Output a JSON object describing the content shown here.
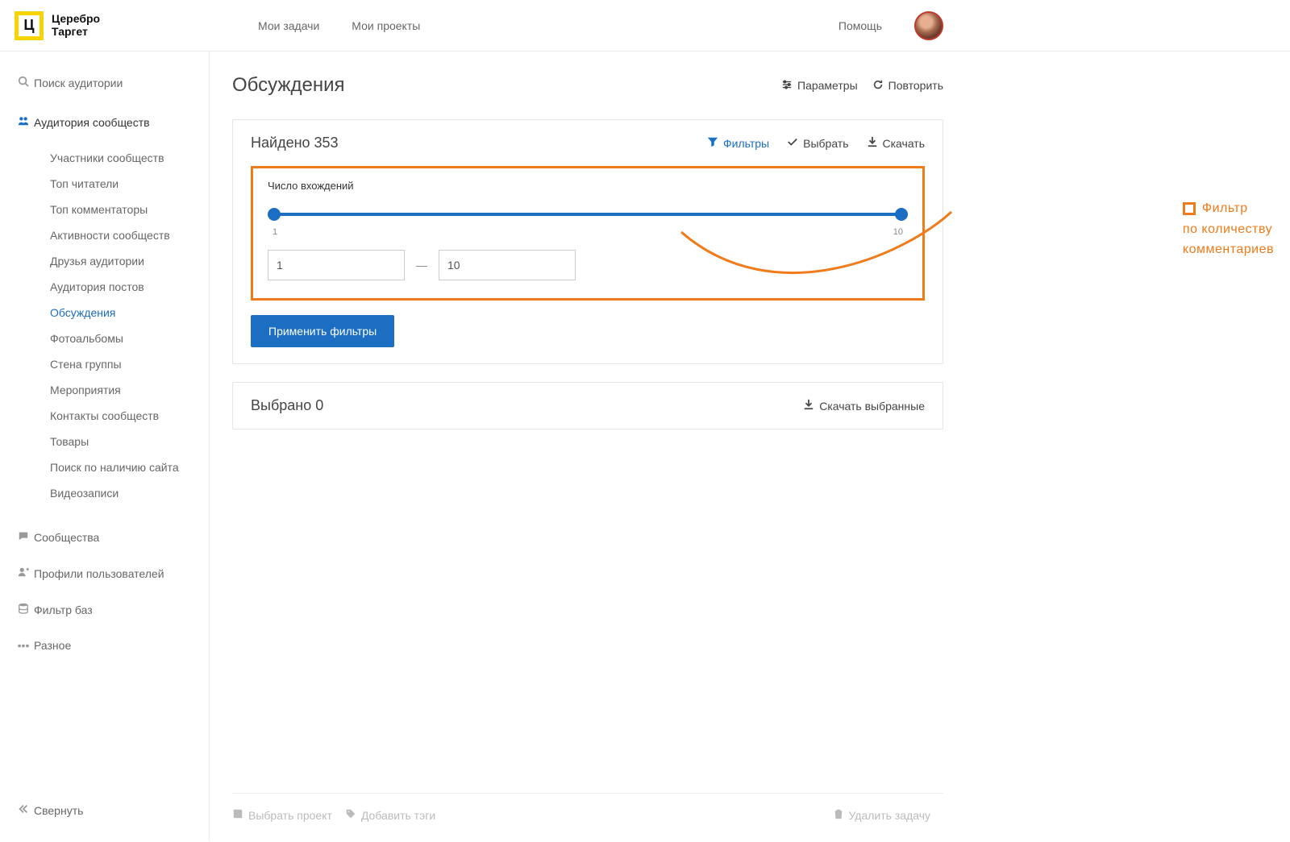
{
  "logo": {
    "letter": "Ц",
    "line1": "Церебро",
    "line2": "Таргет"
  },
  "topnav": {
    "tasks": "Мои задачи",
    "projects": "Мои проекты",
    "help": "Помощь"
  },
  "sidebar": {
    "search": "Поиск аудитории",
    "group_title": "Аудитория сообществ",
    "subs": [
      "Участники сообществ",
      "Топ читатели",
      "Топ комментаторы",
      "Активности сообществ",
      "Друзья аудитории",
      "Аудитория постов",
      "Обсуждения",
      "Фотоальбомы",
      "Стена группы",
      "Мероприятия",
      "Контакты сообществ",
      "Товары",
      "Поиск по наличию сайта",
      "Видеозаписи"
    ],
    "communities": "Сообщества",
    "profiles": "Профили пользователей",
    "filter_db": "Фильтр баз",
    "misc": "Разное",
    "collapse": "Свернуть"
  },
  "page": {
    "title": "Обсуждения",
    "params": "Параметры",
    "repeat": "Повторить"
  },
  "found": {
    "label": "Найдено 353",
    "filters": "Фильтры",
    "select": "Выбрать",
    "download": "Скачать"
  },
  "filter": {
    "title": "Число вхождений",
    "min_tick": "1",
    "max_tick": "10",
    "from_value": "1",
    "to_value": "10",
    "apply": "Применить фильтры"
  },
  "selected": {
    "label": "Выбрано 0",
    "download": "Скачать выбранные"
  },
  "footer": {
    "select_project": "Выбрать проект",
    "add_tags": "Добавить тэги",
    "delete_task": "Удалить задачу"
  },
  "annotation": {
    "line1": "Фильтр",
    "line2": "по количеству",
    "line3": "комментариев"
  }
}
